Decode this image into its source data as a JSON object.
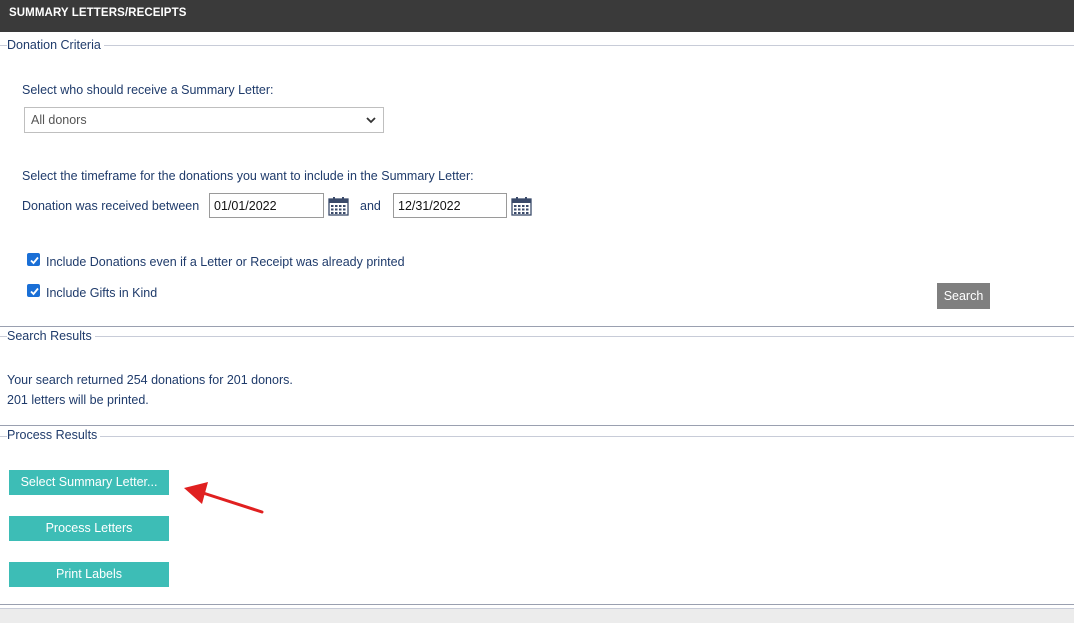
{
  "header": {
    "title": "SUMMARY LETTERS/RECEIPTS"
  },
  "donation_criteria": {
    "legend": "Donation Criteria",
    "recipient_label": "Select who should receive a Summary Letter:",
    "recipient_selected": "All donors",
    "timeframe_label": "Select the timeframe for the donations you want to include in the Summary Letter:",
    "received_between_label": "Donation was received between",
    "start_date": "01/01/2022",
    "and_label": "and",
    "end_date": "12/31/2022",
    "include_printed_label": "Include Donations even if a Letter or Receipt was already printed",
    "include_printed_checked": true,
    "include_gik_label": "Include Gifts in Kind",
    "include_gik_checked": true,
    "search_label": "Search"
  },
  "search_results": {
    "legend": "Search Results",
    "line1": "Your search returned 254 donations for 201 donors.",
    "line2": "201 letters will be printed."
  },
  "process_results": {
    "legend": "Process Results",
    "select_letter_label": "Select Summary Letter...",
    "process_letters_label": "Process Letters",
    "print_labels_label": "Print Labels"
  },
  "colors": {
    "header_bg": "#3a3a3a",
    "accent_teal": "#3dbdb6",
    "text_navy": "#1f3b6b",
    "search_button": "#7f7f7f",
    "annotation_arrow": "#e02020"
  }
}
